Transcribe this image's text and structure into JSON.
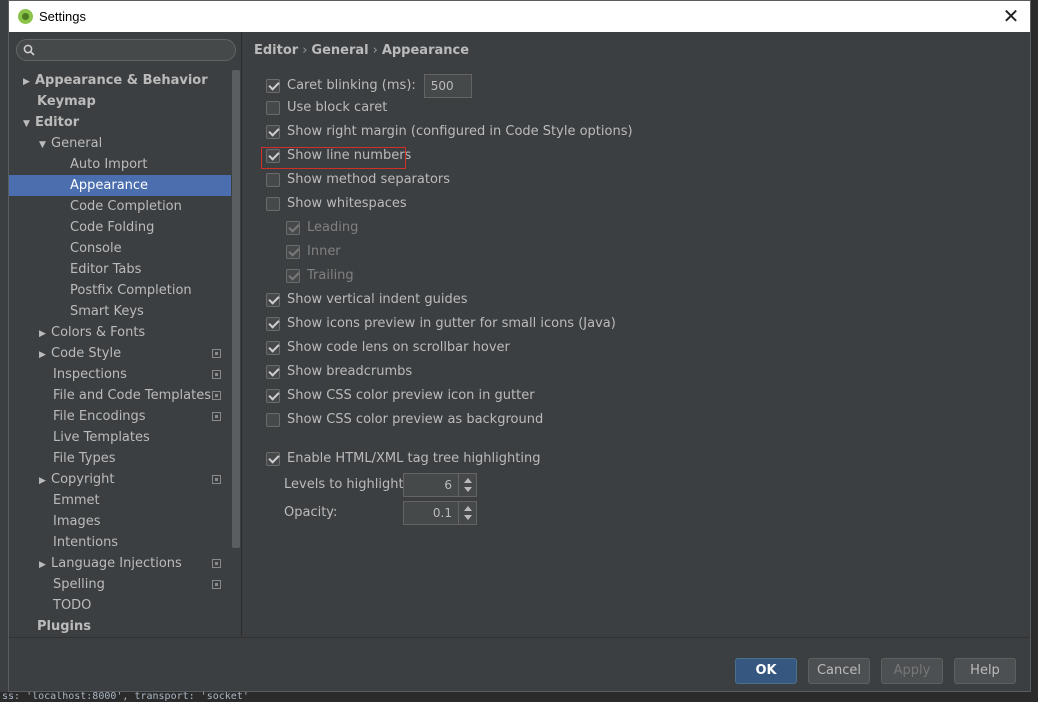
{
  "window": {
    "title": "Settings",
    "close_glyph": "✕"
  },
  "search": {
    "placeholder": ""
  },
  "tree": [
    {
      "label": "Appearance & Behavior",
      "bold": true,
      "indent": 0,
      "arrow": "right"
    },
    {
      "label": "Keymap",
      "bold": true,
      "indent": 0,
      "arrow": "none"
    },
    {
      "label": "Editor",
      "bold": true,
      "indent": 0,
      "arrow": "down"
    },
    {
      "label": "General",
      "bold": false,
      "indent": 1,
      "arrow": "down"
    },
    {
      "label": "Auto Import",
      "bold": false,
      "indent": 2,
      "arrow": "none"
    },
    {
      "label": "Appearance",
      "bold": false,
      "indent": 2,
      "arrow": "none",
      "selected": true
    },
    {
      "label": "Code Completion",
      "bold": false,
      "indent": 2,
      "arrow": "none"
    },
    {
      "label": "Code Folding",
      "bold": false,
      "indent": 2,
      "arrow": "none"
    },
    {
      "label": "Console",
      "bold": false,
      "indent": 2,
      "arrow": "none"
    },
    {
      "label": "Editor Tabs",
      "bold": false,
      "indent": 2,
      "arrow": "none"
    },
    {
      "label": "Postfix Completion",
      "bold": false,
      "indent": 2,
      "arrow": "none"
    },
    {
      "label": "Smart Keys",
      "bold": false,
      "indent": 2,
      "arrow": "none"
    },
    {
      "label": "Colors & Fonts",
      "bold": false,
      "indent": 1,
      "arrow": "right"
    },
    {
      "label": "Code Style",
      "bold": false,
      "indent": 1,
      "arrow": "right",
      "project": true
    },
    {
      "label": "Inspections",
      "bold": false,
      "indent": 1,
      "arrow": "none",
      "project": true
    },
    {
      "label": "File and Code Templates",
      "bold": false,
      "indent": 1,
      "arrow": "none",
      "project": true
    },
    {
      "label": "File Encodings",
      "bold": false,
      "indent": 1,
      "arrow": "none",
      "project": true
    },
    {
      "label": "Live Templates",
      "bold": false,
      "indent": 1,
      "arrow": "none"
    },
    {
      "label": "File Types",
      "bold": false,
      "indent": 1,
      "arrow": "none"
    },
    {
      "label": "Copyright",
      "bold": false,
      "indent": 1,
      "arrow": "right",
      "project": true
    },
    {
      "label": "Emmet",
      "bold": false,
      "indent": 1,
      "arrow": "none"
    },
    {
      "label": "Images",
      "bold": false,
      "indent": 1,
      "arrow": "none"
    },
    {
      "label": "Intentions",
      "bold": false,
      "indent": 1,
      "arrow": "none"
    },
    {
      "label": "Language Injections",
      "bold": false,
      "indent": 1,
      "arrow": "right",
      "project": true
    },
    {
      "label": "Spelling",
      "bold": false,
      "indent": 1,
      "arrow": "none",
      "project": true
    },
    {
      "label": "TODO",
      "bold": false,
      "indent": 1,
      "arrow": "none"
    },
    {
      "label": "Plugins",
      "bold": true,
      "indent": 0,
      "arrow": "none"
    }
  ],
  "breadcrumb": {
    "part1": "Editor",
    "part2": "General",
    "part3": "Appearance",
    "sep": "›"
  },
  "options": {
    "caret_blinking": {
      "label": "Caret blinking (ms):",
      "checked": true,
      "value": "500"
    },
    "block_caret": {
      "label": "Use block caret",
      "checked": false
    },
    "right_margin": {
      "label": "Show right margin (configured in Code Style options)",
      "checked": true
    },
    "line_numbers": {
      "label": "Show line numbers",
      "checked": true
    },
    "method_separators": {
      "label": "Show method separators",
      "checked": false
    },
    "whitespaces": {
      "label": "Show whitespaces",
      "checked": false
    },
    "leading": {
      "label": "Leading",
      "checked": true
    },
    "inner": {
      "label": "Inner",
      "checked": true
    },
    "trailing": {
      "label": "Trailing",
      "checked": true
    },
    "indent_guides": {
      "label": "Show vertical indent guides",
      "checked": true
    },
    "icons_preview": {
      "label": "Show icons preview in gutter for small icons (Java)",
      "checked": true
    },
    "code_lens": {
      "label": "Show code lens on scrollbar hover",
      "checked": true
    },
    "breadcrumbs": {
      "label": "Show breadcrumbs",
      "checked": true
    },
    "css_color_icon": {
      "label": "Show CSS color preview icon in gutter",
      "checked": true
    },
    "css_color_bg": {
      "label": "Show CSS color preview as background",
      "checked": false
    },
    "tag_tree": {
      "label": "Enable HTML/XML tag tree highlighting",
      "checked": true
    }
  },
  "levels": {
    "label": "Levels to highlight:",
    "value": "6"
  },
  "opacity": {
    "label": "Opacity:",
    "value": "0.1"
  },
  "buttons": {
    "ok": "OK",
    "cancel": "Cancel",
    "apply": "Apply",
    "help": "Help"
  },
  "background_text": "ss: 'localhost:8000', transport: 'socket'",
  "colors": {
    "selection": "#4b6eaf",
    "highlight_box": "#d0302a",
    "ok_button": "#365880"
  }
}
